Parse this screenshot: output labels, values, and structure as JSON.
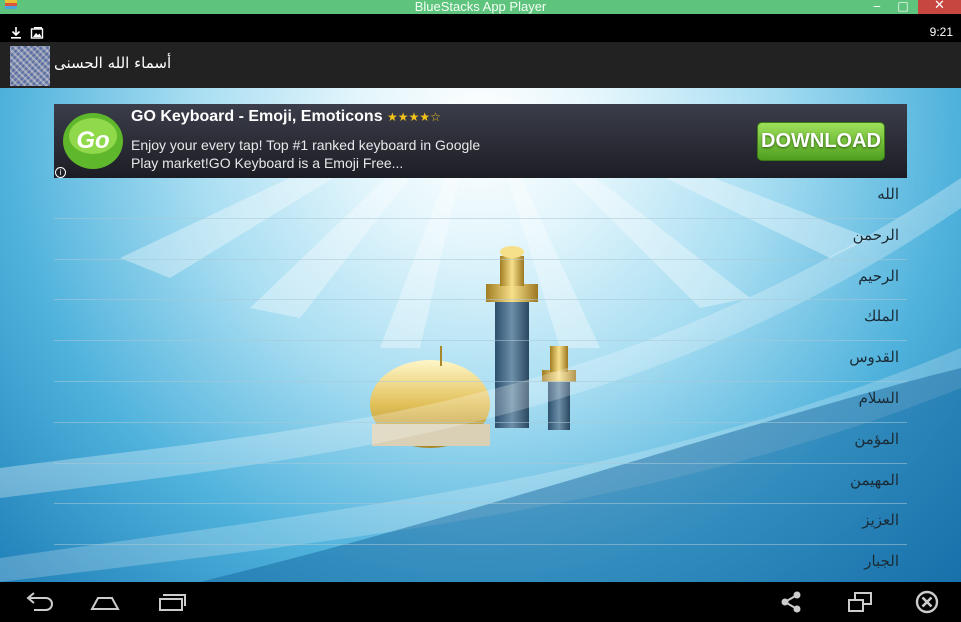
{
  "window": {
    "title": "BlueStacks App Player",
    "minimize_symbol": "‒",
    "maximize_symbol": "□",
    "close_symbol": "✕"
  },
  "statusbar": {
    "time": "9:21",
    "icons": [
      "download-icon",
      "image-notification-icon"
    ]
  },
  "app": {
    "title": "أسماء الله الحسنى",
    "logo_icon": "app-logo-icon"
  },
  "ad": {
    "title": "GO Keyboard - Emoji, Emoticons",
    "stars": "★★★★☆",
    "rating": 4.5,
    "description": "Enjoy your every tap!  Top #1 ranked keyboard in Google Play market!GO Keyboard is a Emoji Free...",
    "button_label": "DOWNLOAD",
    "info_symbol": "i"
  },
  "names": [
    {
      "label": "الله"
    },
    {
      "label": "الرحمن"
    },
    {
      "label": "الرحيم"
    },
    {
      "label": "الملك"
    },
    {
      "label": "القدوس"
    },
    {
      "label": "السلام"
    },
    {
      "label": "المؤمن"
    },
    {
      "label": "المهيمن"
    },
    {
      "label": "العزيز"
    },
    {
      "label": "الجبار"
    }
  ],
  "navbar": {
    "icons": [
      "back-icon",
      "home-icon",
      "recent-apps-icon",
      "share-icon",
      "screen-rotate-icon",
      "close-app-icon"
    ]
  },
  "colors": {
    "titlebar": "#5ec37c",
    "close_button": "#c7463f",
    "download_button": "#6cc03a",
    "star": "#f3c21b"
  }
}
